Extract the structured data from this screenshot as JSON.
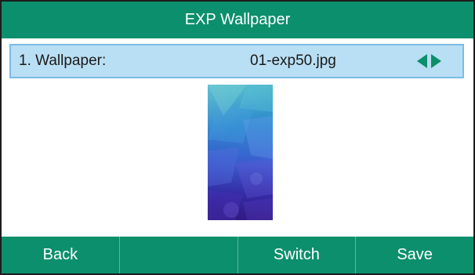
{
  "title": "EXP Wallpaper",
  "setting": {
    "label": "1. Wallpaper:",
    "value": "01-exp50.jpg",
    "left_arrow_icon": "triangle-left-icon",
    "right_arrow_icon": "triangle-right-icon"
  },
  "preview": {
    "description_colors": [
      "#3fb3c6",
      "#2f89cf",
      "#3d5fd6",
      "#3a2fb0",
      "#3a1f8f"
    ]
  },
  "softkeys": [
    {
      "label": "Back"
    },
    {
      "label": ""
    },
    {
      "label": "Switch"
    },
    {
      "label": "Save"
    }
  ],
  "colors": {
    "accent": "#0c8f6c",
    "highlight_row": "#b9dff4",
    "highlight_border": "#7bbbe6"
  }
}
